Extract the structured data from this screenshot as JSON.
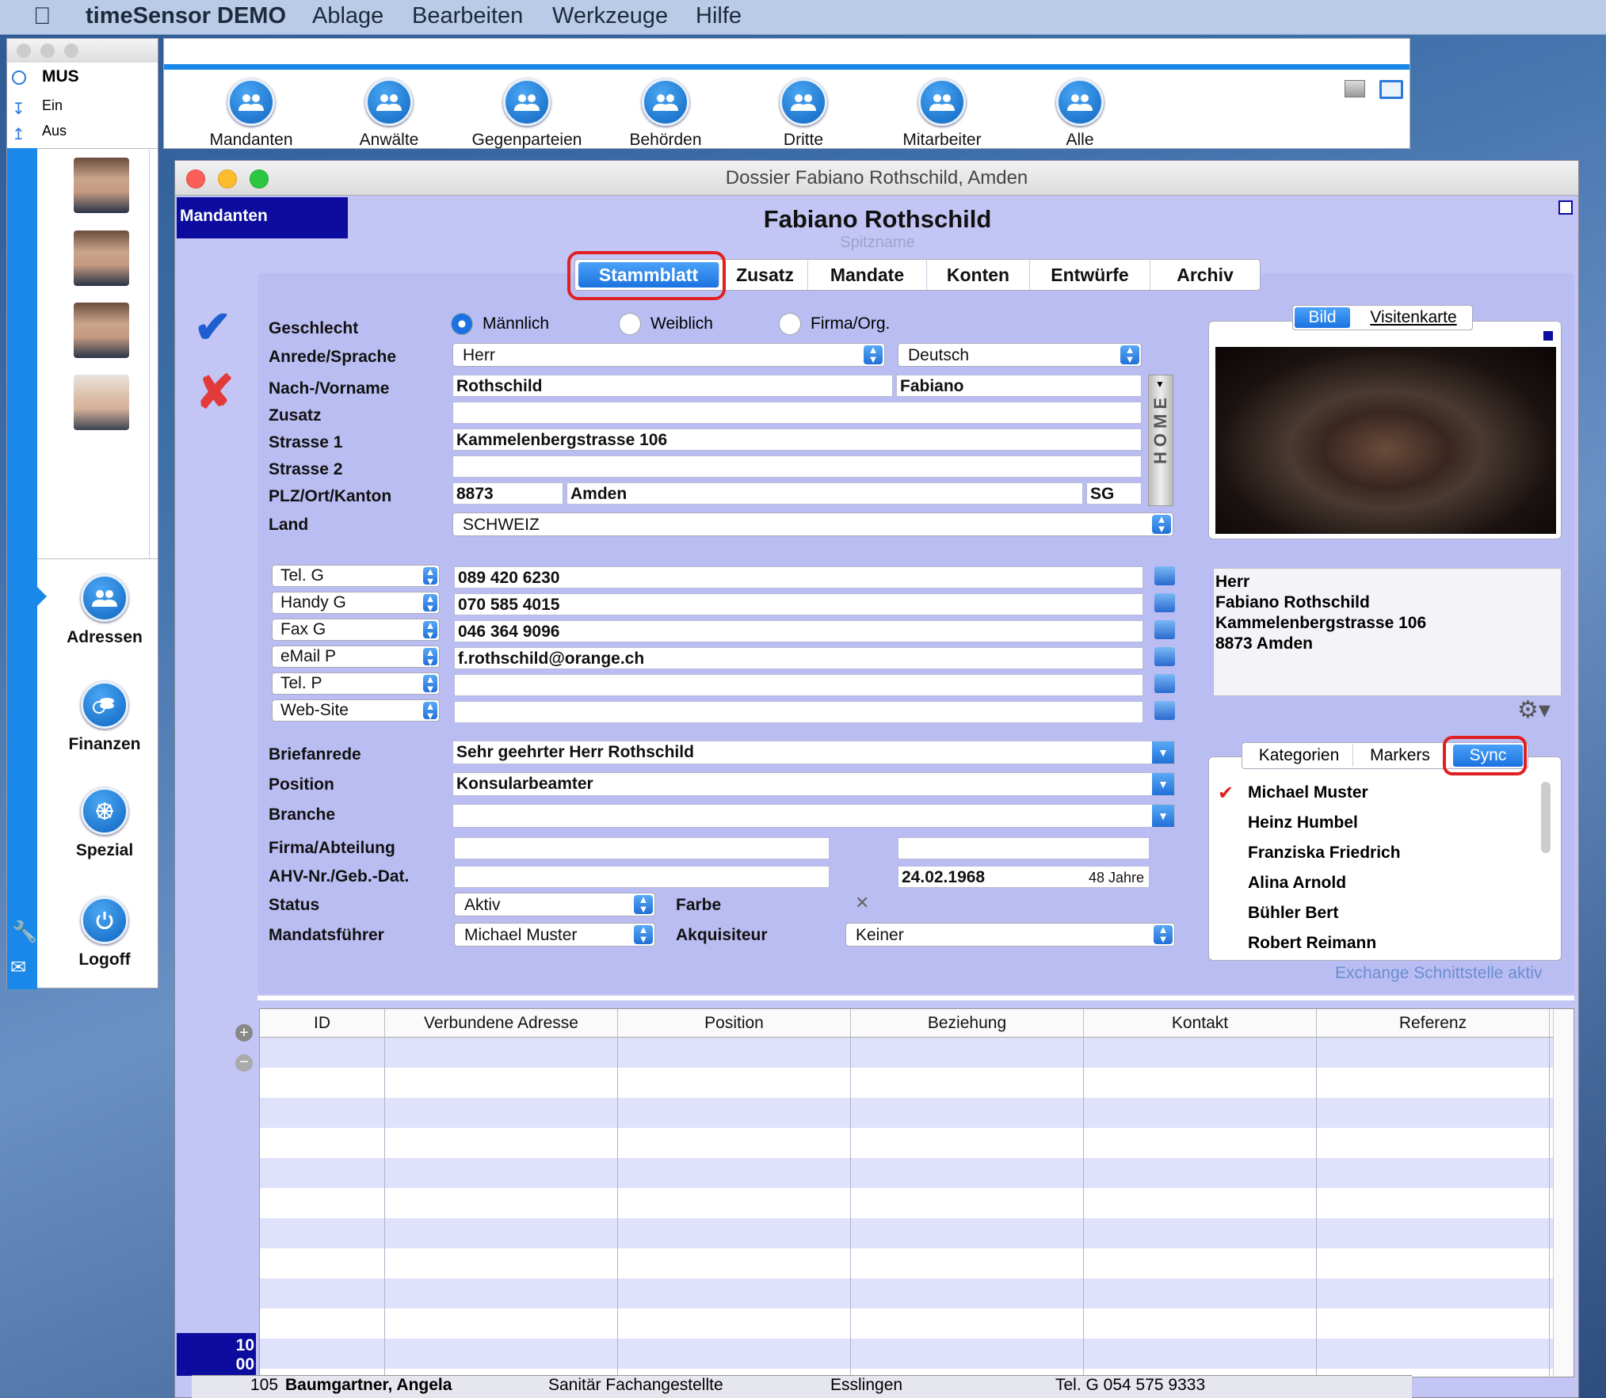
{
  "menubar": {
    "app": "timeSensor DEMO",
    "items": [
      "Ablage",
      "Bearbeiten",
      "Werkzeuge",
      "Hilfe"
    ]
  },
  "toolbar": {
    "buttons": [
      "Mandanten",
      "Anwälte",
      "Gegenparteien",
      "Behörden",
      "Dritte",
      "Mitarbeiter",
      "Alle"
    ]
  },
  "sidebar": {
    "user": "MUS",
    "in_label": "Ein",
    "out_label": "Aus",
    "nav": [
      "Adressen",
      "Finanzen",
      "Spezial",
      "Logoff"
    ]
  },
  "window": {
    "title": "Dossier Fabiano Rothschild, Amden",
    "category": "Mandanten",
    "name": "Fabiano Rothschild",
    "nickname_placeholder": "Spitzname"
  },
  "tabs": [
    "Stammblatt",
    "Zusatz",
    "Mandate",
    "Konten",
    "Entwürfe",
    "Archiv"
  ],
  "form": {
    "labels": {
      "gender": "Geschlecht",
      "salutation": "Anrede/Sprache",
      "name": "Nach-/Vorname",
      "suffix": "Zusatz",
      "street1": "Strasse 1",
      "street2": "Strasse 2",
      "zip": "PLZ/Ort/Kanton",
      "country": "Land",
      "letter": "Briefanrede",
      "position": "Position",
      "branch": "Branche",
      "company": "Firma/Abteilung",
      "ahv": "AHV-Nr./Geb.-Dat.",
      "status": "Status",
      "manager": "Mandatsführer",
      "color": "Farbe",
      "acquisitor": "Akquisiteur"
    },
    "gender_options": [
      "Männlich",
      "Weiblich",
      "Firma/Org."
    ],
    "salutation": "Herr",
    "language": "Deutsch",
    "last_name": "Rothschild",
    "first_name": "Fabiano",
    "street1": "Kammelenbergstrasse 106",
    "zip": "8873",
    "city": "Amden",
    "canton": "SG",
    "country": "SCHWEIZ",
    "home_label": "HOME",
    "contacts": [
      {
        "type": "Tel. G",
        "value": "089 420 6230"
      },
      {
        "type": "Handy G",
        "value": "070 585 4015"
      },
      {
        "type": "Fax G",
        "value": "046 364 9096"
      },
      {
        "type": "eMail P",
        "value": "f.rothschild@orange.ch"
      },
      {
        "type": "Tel. P",
        "value": ""
      },
      {
        "type": "Web-Site",
        "value": ""
      }
    ],
    "letter": "Sehr geehrter Herr Rothschild",
    "position": "Konsularbeamter",
    "birth": "24.02.1968",
    "age": "48 Jahre",
    "status": "Aktiv",
    "manager": "Michael Muster",
    "acquisitor": "Keiner"
  },
  "photo_tabs": [
    "Bild",
    "Visitenkarte"
  ],
  "address_block": [
    "Herr",
    "Fabiano Rothschild",
    "Kammelenbergstrasse 106",
    "8873 Amden"
  ],
  "right_tabs": [
    "Kategorien",
    "Markers",
    "Sync"
  ],
  "sync_list": [
    "Michael Muster",
    "Heinz Humbel",
    "Franziska Friedrich",
    "Alina Arnold",
    "Bühler Bert",
    "Robert Reimann"
  ],
  "exchange_status": "Exchange Schnittstelle aktiv",
  "table": {
    "columns": [
      "ID",
      "Verbundene Adresse",
      "Position",
      "Beziehung",
      "Kontakt",
      "Referenz"
    ]
  },
  "counter": [
    "10",
    "00"
  ],
  "behind_row": {
    "id": "105",
    "name": "Baumgartner, Angela",
    "position": "Sanitär Fachangestellte",
    "city": "Esslingen",
    "contact": "Tel. G 054 575 9333"
  },
  "colors": {
    "accent": "#1a88e8",
    "window_bg": "#c3c5f4",
    "navy": "#0c0c9e",
    "highlight": "#e02020"
  }
}
